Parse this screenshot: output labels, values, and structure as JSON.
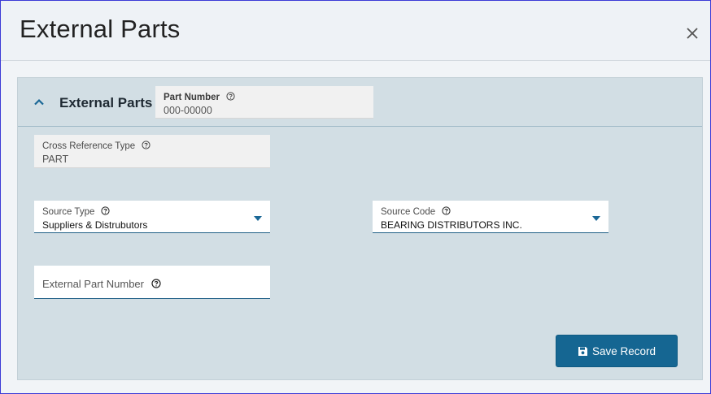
{
  "dialog": {
    "title": "External Parts",
    "close_icon": "close-icon"
  },
  "panel": {
    "title": "External Parts",
    "collapse_icon": "chevron-up-icon"
  },
  "fields": {
    "part_number": {
      "label": "Part Number",
      "value": "000-00000"
    },
    "cross_reference_type": {
      "label": "Cross Reference Type",
      "value": "PART"
    },
    "source_type": {
      "label": "Source Type",
      "value": "Suppliers & Distrubutors"
    },
    "source_code": {
      "label": "Source Code",
      "value": "BEARING DISTRIBUTORS INC."
    },
    "external_part_number": {
      "label": "External Part Number",
      "value": ""
    }
  },
  "actions": {
    "save_label": "Save Record",
    "save_icon": "save-icon"
  },
  "colors": {
    "accent": "#156692",
    "panel_bg": "#d2dee4"
  }
}
